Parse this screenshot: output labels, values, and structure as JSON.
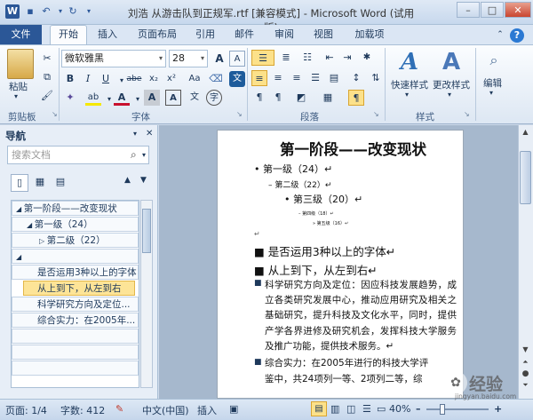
{
  "window": {
    "title": "刘浩 从游击队到正规军.rtf [兼容模式] - Microsoft Word (试用版)",
    "minimize": "–",
    "maximize": "□",
    "close": "✕"
  },
  "tabs": [
    {
      "label": "文件"
    },
    {
      "label": "开始"
    },
    {
      "label": "插入"
    },
    {
      "label": "页面布局"
    },
    {
      "label": "引用"
    },
    {
      "label": "邮件"
    },
    {
      "label": "审阅"
    },
    {
      "label": "视图"
    },
    {
      "label": "加载项"
    }
  ],
  "ribbon": {
    "clipboard": {
      "paste": "粘贴",
      "group": "剪贴板"
    },
    "font": {
      "name": "微软雅黑",
      "size": "28",
      "group": "字体",
      "bold": "B",
      "italic": "I",
      "underline": "U",
      "strike": "abe",
      "sub": "x₂",
      "sup": "x²",
      "grow": "A",
      "shrink": "A",
      "color_a": "A",
      "aa": "Aa",
      "wen": "文",
      "a_letter": "A"
    },
    "paragraph": {
      "group": "段落"
    },
    "styles": {
      "quick": "快速样式",
      "change": "更改样式",
      "group": "样式"
    },
    "editing": {
      "label": "编辑"
    }
  },
  "nav": {
    "header": "导航",
    "search_placeholder": "搜索文档",
    "items": [
      "第一阶段——改变现状",
      "第一级（24）",
      "第二级（22）",
      "",
      "是否运用3种以上的字体",
      "从上到下，从左到右",
      "科学研究方向及定位...",
      "综合实力：在2005年..."
    ]
  },
  "doc": {
    "heading": "第一阶段——改变现状",
    "l1": "第一级（24）↵",
    "l2": "第二级（22）↵",
    "l3": "第三级（20）↵",
    "l4": "第四级（18）↵",
    "l5": "第五级（16）↵",
    "dot": "↵",
    "b1": "是否运用3种以上的字体↵",
    "b2": "从上到下，从左到右↵",
    "p1": "科学研究方向及定位：因应科技发展趋势，成立各类研究发展中心，推动应用研究及相关之基础研究，提升科技及文化水平，同时，提供产学各界进修及研究机会，发挥科技大学服务及推广功能，提供技术服务。↵",
    "p2a": "综合实力：在2005年进行的科技大学评",
    "p2b": "鉴中，共24项列一等、2项列二等，综"
  },
  "status": {
    "page": "页面: 1/4",
    "words": "字数: 412",
    "lang": "中文(中国)",
    "insert": "插入",
    "zoom": "40%",
    "minus": "–",
    "plus": "+"
  },
  "watermark": {
    "text": "经验",
    "domain": "jingyan.baidu.com"
  },
  "colors": {
    "file_tab": "#2b5797",
    "highlight_row": "#fde497"
  }
}
